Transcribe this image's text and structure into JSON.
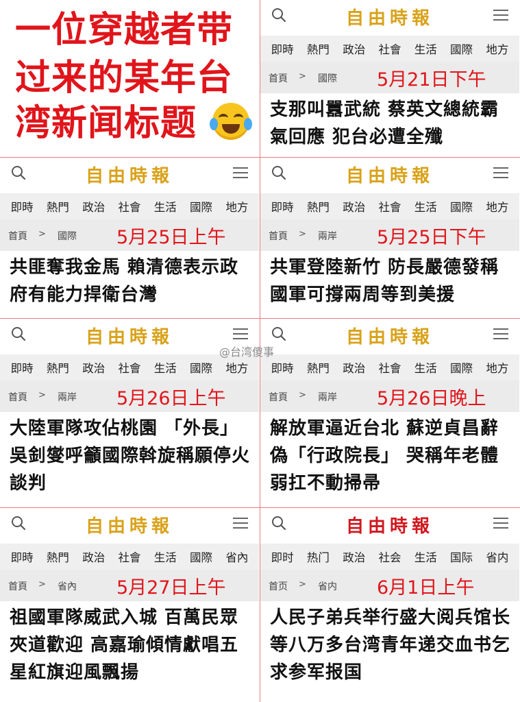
{
  "title": {
    "lines": [
      "一位穿越者带",
      "过来的某年台",
      "湾新闻标题"
    ],
    "emoji": "laughing-with-tears-emoji"
  },
  "watermark": "@台湾傻事",
  "brand_color": "#d9a21a",
  "accent_color": "#e0151b",
  "cards": [
    {
      "logo": "自由時報",
      "nav": [
        "即時",
        "熱門",
        "政治",
        "社會",
        "生活",
        "國際",
        "地方"
      ],
      "home": "首頁",
      "sep": ">",
      "section": "國際",
      "date": "5月21日下午",
      "headline": "支那叫囂武統 蔡英文總統霸氣回應 犯台必遭全殲"
    },
    {
      "logo": "自由時報",
      "nav": [
        "即時",
        "熱門",
        "政治",
        "社會",
        "生活",
        "國際",
        "地方"
      ],
      "home": "首頁",
      "sep": ">",
      "section": "國際",
      "date": "5月25日上午",
      "headline": "共匪奪我金馬 賴清德表示政府有能力捍衛台灣"
    },
    {
      "logo": "自由時報",
      "nav": [
        "即時",
        "熱門",
        "政治",
        "社會",
        "生活",
        "國際",
        "地方"
      ],
      "home": "首頁",
      "sep": ">",
      "section": "兩岸",
      "date": "5月25日下午",
      "headline": "共軍登陸新竹 防長嚴德發稱國軍可撐兩周等到美援"
    },
    {
      "logo": "自由時報",
      "nav": [
        "即時",
        "熱門",
        "政治",
        "社會",
        "生活",
        "國際",
        "地方"
      ],
      "home": "首頁",
      "sep": ">",
      "section": "兩岸",
      "date": "5月26日上午",
      "headline": "大陸軍隊攻佔桃園 「外長」吳釗燮呼籲國際斡旋稱願停火談判"
    },
    {
      "logo": "自由時報",
      "nav": [
        "即時",
        "熱門",
        "政治",
        "社會",
        "生活",
        "國際",
        "地方"
      ],
      "home": "首頁",
      "sep": ">",
      "section": "兩岸",
      "date": "5月26日晚上",
      "headline": "解放軍逼近台北 蘇逆貞昌辭偽「行政院長」 哭稱年老體弱扛不動掃帚"
    },
    {
      "logo": "自由時報",
      "nav": [
        "即時",
        "熱門",
        "政治",
        "社會",
        "生活",
        "國際",
        "省內"
      ],
      "home": "首頁",
      "sep": ">",
      "section": "省內",
      "date": "5月27日上午",
      "headline": "祖國軍隊威武入城 百萬民眾夾道歡迎 高嘉瑜傾情獻唱五星紅旗迎風飄揚"
    },
    {
      "logo": "自由時報",
      "nav": [
        "即时",
        "热门",
        "政治",
        "社会",
        "生活",
        "国际",
        "省内"
      ],
      "home": "首页",
      "sep": ">",
      "section": "省内",
      "date": "6月1日上午",
      "headline": "人民子弟兵举行盛大阅兵馆长等八万多台湾青年递交血书乞求参军报国"
    }
  ]
}
